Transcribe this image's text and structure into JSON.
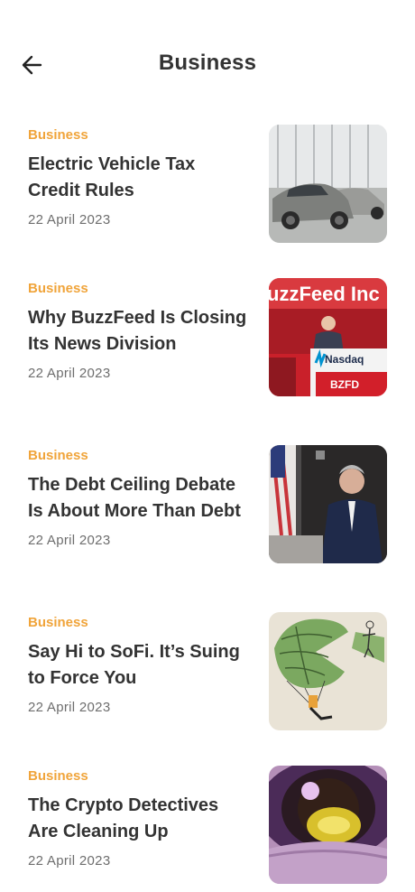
{
  "header": {
    "title": "Business",
    "back_icon": "arrow-left-icon"
  },
  "articles": [
    {
      "category": "Business",
      "title": "Electric Vehicle Tax Credit Rules",
      "date": "22 April 2023",
      "image": "electric-car-showroom-image"
    },
    {
      "category": "Business",
      "title": "Why BuzzFeed Is Closing Its News Division",
      "date": "22 April 2023",
      "image": "buzzfeed-nasdaq-image",
      "image_text": {
        "banner": "uzzFeed Inc",
        "podium": "Nasdaq",
        "ticker": "BZFD"
      }
    },
    {
      "category": "Business",
      "title": "The Debt Ceiling Debate Is About More Than Debt",
      "date": "22 April 2023",
      "image": "speaker-seated-flags-image"
    },
    {
      "category": "Business",
      "title": "Say Hi to SoFi. It’s Suing to Force You",
      "date": "22 April 2023",
      "image": "parachute-illustration-image"
    },
    {
      "category": "Business",
      "title": "The Crypto Detectives Are Cleaning Up",
      "date": "22 April 2023",
      "image": "eye-closeup-image"
    }
  ]
}
